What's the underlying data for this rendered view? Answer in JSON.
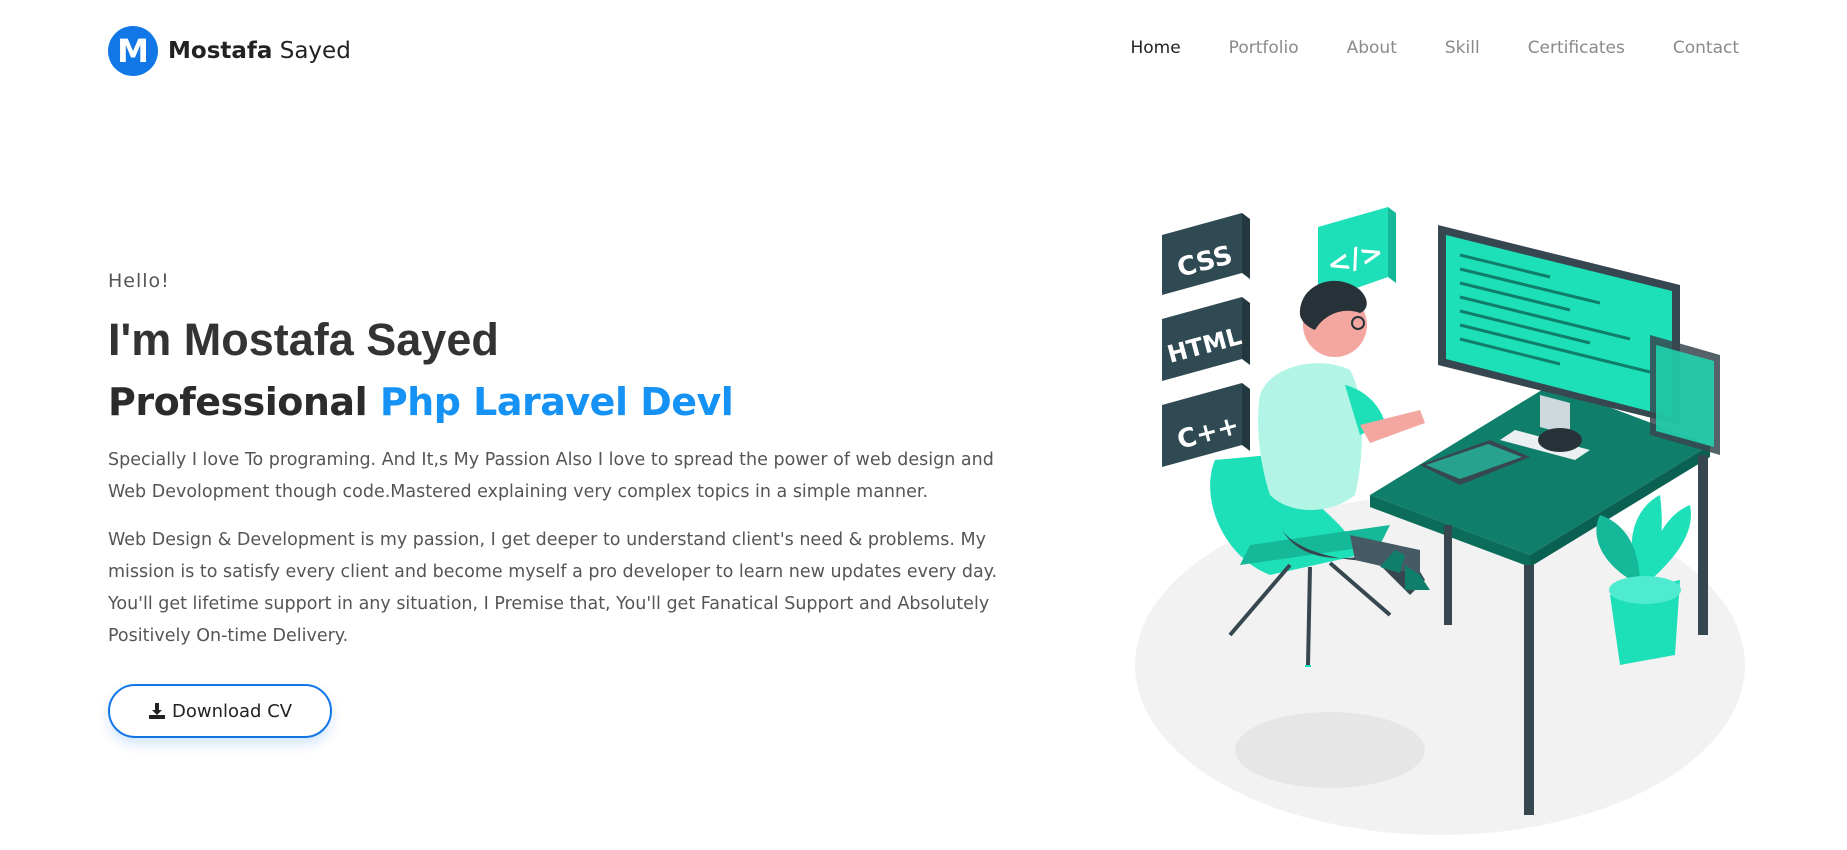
{
  "brand": {
    "logo_letter": "M",
    "first": "Mostafa",
    "last": "Sayed"
  },
  "nav": {
    "items": [
      {
        "label": "Home",
        "active": true
      },
      {
        "label": "Portfolio",
        "active": false
      },
      {
        "label": "About",
        "active": false
      },
      {
        "label": "Skill",
        "active": false
      },
      {
        "label": "Certificates",
        "active": false
      },
      {
        "label": "Contact",
        "active": false
      }
    ]
  },
  "hero": {
    "greeting": "Hello!",
    "im_prefix": "I'm",
    "name": "Mostafa Sayed",
    "role_prefix": "Professional",
    "role_typed": "Php Laravel Devl",
    "paragraph1": "Specially I love To programing. And It,s My Passion Also I love to spread the power of web design and Web Devolopment though code.Mastered explaining very complex topics in a simple manner.",
    "paragraph2": "Web Design & Development is my passion, I get deeper to understand client's need & problems. My mission is to satisfy every client and become myself a pro developer to learn new updates every day. You'll get lifetime support in any situation, I Premise that, You'll get Fanatical Support and Absolutely Positively On-time Delivery.",
    "cv_button": "Download CV"
  },
  "illustration": {
    "tags": [
      "CSS",
      "HTML",
      "C++"
    ],
    "code_bubble": "</>"
  },
  "colors": {
    "brand_blue": "#1177e6",
    "accent_blue": "#1592f4",
    "teal": "#1de0b9",
    "dark_teal": "#0f7f6b",
    "slate": "#37474f"
  }
}
